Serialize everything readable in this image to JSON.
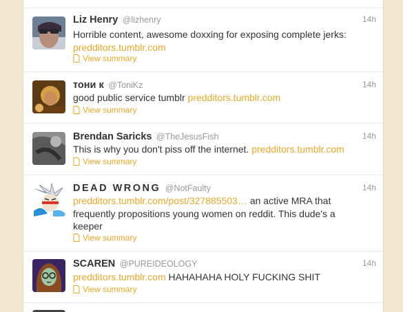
{
  "tweets": [
    {
      "name": "Liz Henry",
      "handle": "@lizhenry",
      "time": "14h",
      "text_before": "Horrible content, awesome doxxing for exposing complete jerks:",
      "link": "predditors.tumblr.com",
      "text_after": "",
      "summary": "View summary",
      "avatar": "avatar-sunglasses-woman"
    },
    {
      "name": "тони к",
      "handle": "@ToniKz",
      "time": "14h",
      "text_before": "good public service tumblr",
      "link": "predditors.tumblr.com",
      "text_after": "",
      "summary": "View summary",
      "avatar": "avatar-blond-person"
    },
    {
      "name": "Brendan Saricks",
      "handle": "@TheJesusFish",
      "time": "14h",
      "text_before": "This is why you don't piss off the internet.",
      "link": "predditors.tumblr.com",
      "text_after": "",
      "summary": "View summary",
      "avatar": "avatar-grayscale-blur"
    },
    {
      "name": "DEAD WRONG",
      "handle": "@NotFaulty",
      "time": "14h",
      "text_before": "",
      "link": "predditors.tumblr.com/post/327885503…",
      "text_after": "an active MRA that frequently propositions young women on reddit. This dude's a keeper",
      "summary": "View summary",
      "avatar": "avatar-anime-character"
    },
    {
      "name": "SCAREN",
      "handle": "@PUREIDEOLOGY",
      "time": "14h",
      "text_before": "",
      "link": "predditors.tumblr.com",
      "text_after": "HAHAHAHA HOLY FUCKING SHIT",
      "summary": "View summary",
      "avatar": "avatar-cartoon-girl"
    }
  ],
  "colors": {
    "link": "#e8a726",
    "background": "#f4e7cf",
    "name": "#333333",
    "meta": "#999999"
  }
}
